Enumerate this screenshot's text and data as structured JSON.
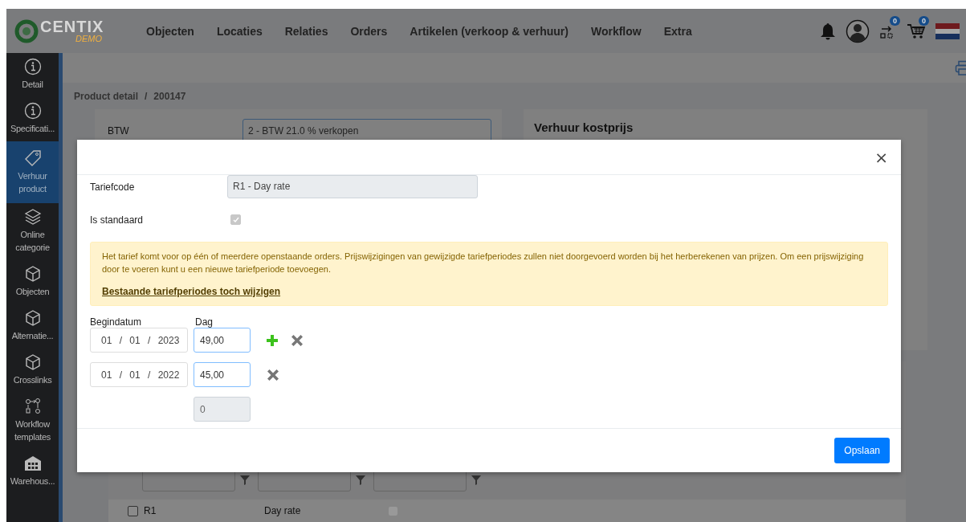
{
  "header": {
    "logo": {
      "name": "CENTIX",
      "sub": "DEMO"
    },
    "nav": [
      {
        "label": "Objecten"
      },
      {
        "label": "Locaties"
      },
      {
        "label": "Relaties"
      },
      {
        "label": "Orders"
      },
      {
        "label": "Artikelen (verkoop & verhuur)"
      },
      {
        "label": "Workflow"
      },
      {
        "label": "Extra"
      }
    ],
    "queue_badge": "0",
    "cart_badge": "0"
  },
  "sidebar": {
    "items": [
      {
        "label": "Detail",
        "kind": "info",
        "selected": false
      },
      {
        "label": "Specificati...",
        "kind": "info",
        "selected": false
      },
      {
        "label": "Verhuur product",
        "kind": "tag",
        "selected": true
      },
      {
        "label": "Online categorie",
        "kind": "layers",
        "selected": false
      },
      {
        "label": "Objecten",
        "kind": "cube",
        "selected": false
      },
      {
        "label": "Alternatie...",
        "kind": "cube",
        "selected": false
      },
      {
        "label": "Crosslinks",
        "kind": "cube",
        "selected": false
      },
      {
        "label": "Workflow templates",
        "kind": "workflow",
        "selected": false
      },
      {
        "label": "Warehous...",
        "kind": "warehouse",
        "selected": false
      }
    ]
  },
  "breadcrumb": {
    "items": [
      "Product detail",
      "200147"
    ],
    "separator": "/"
  },
  "product_card": {
    "label": "BTW",
    "value": "2 - BTW 21.0 % verkopen"
  },
  "cost_card": {
    "title": "Verhuur kostprijs"
  },
  "rates_table": {
    "rows": [
      {
        "checked": false,
        "code": "R1",
        "name": "Day rate",
        "standard": true
      }
    ]
  },
  "modal": {
    "close": "×",
    "fields": [
      {
        "kind": "text",
        "label": "Tariefcode",
        "value": "R1 - Day rate"
      },
      {
        "kind": "checkbox",
        "label": "Is standaard",
        "checked": true
      }
    ],
    "alert": {
      "text": "Het tarief komt voor op één of meerdere openstaande orders. Prijswijzigingen van gewijzigde tariefperiodes zullen niet doorgevoerd worden bij het herberekenen van prijzen. Om een prijswijziging door te voeren kunt u een nieuwe tariefperiode toevoegen.",
      "link": "Bestaande tariefperiodes toch wijzigen"
    },
    "columns": [
      "Begindatum",
      "Dag"
    ],
    "periods": [
      {
        "date": "01 / 01 / 2023",
        "price": "49,00",
        "actions": [
          {
            "kind": "add"
          },
          {
            "kind": "remove"
          }
        ]
      },
      {
        "date": "01 / 01 / 2022",
        "price": "45,00",
        "actions": [
          {
            "kind": "remove"
          }
        ]
      }
    ],
    "new_price": "0",
    "save": "Opslaan"
  }
}
